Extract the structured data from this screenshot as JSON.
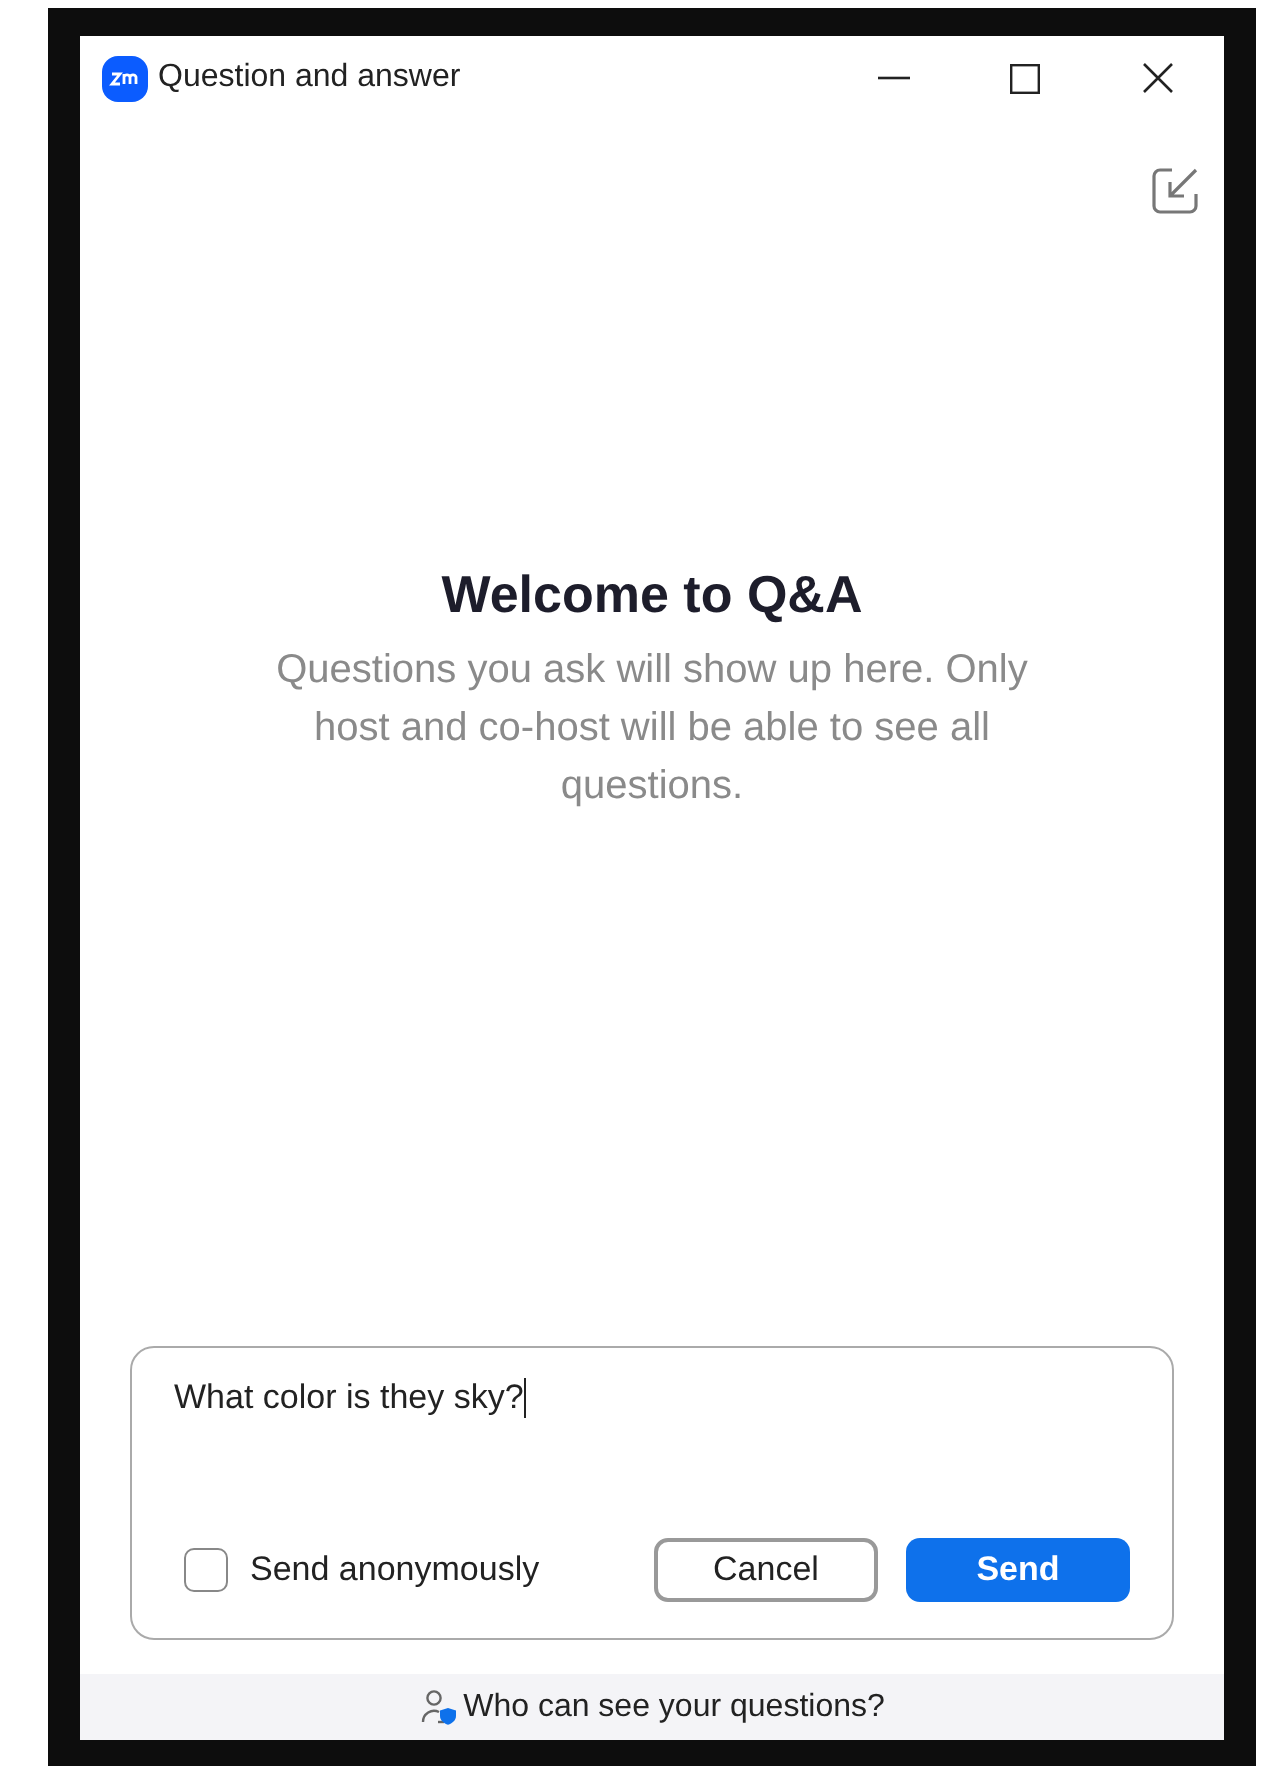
{
  "window": {
    "title": "Question and answer"
  },
  "welcome": {
    "heading": "Welcome to Q&A",
    "message": "Questions you ask will show up here. Only host and co-host will be able to see all questions."
  },
  "compose": {
    "value": "What color is they sky?",
    "anonymous": {
      "label": "Send anonymously",
      "checked": false
    },
    "buttons": [
      {
        "label": "Cancel",
        "kind": "secondary"
      },
      {
        "label": "Send",
        "kind": "primary"
      }
    ]
  },
  "footer": {
    "text": "Who can see your questions?"
  }
}
